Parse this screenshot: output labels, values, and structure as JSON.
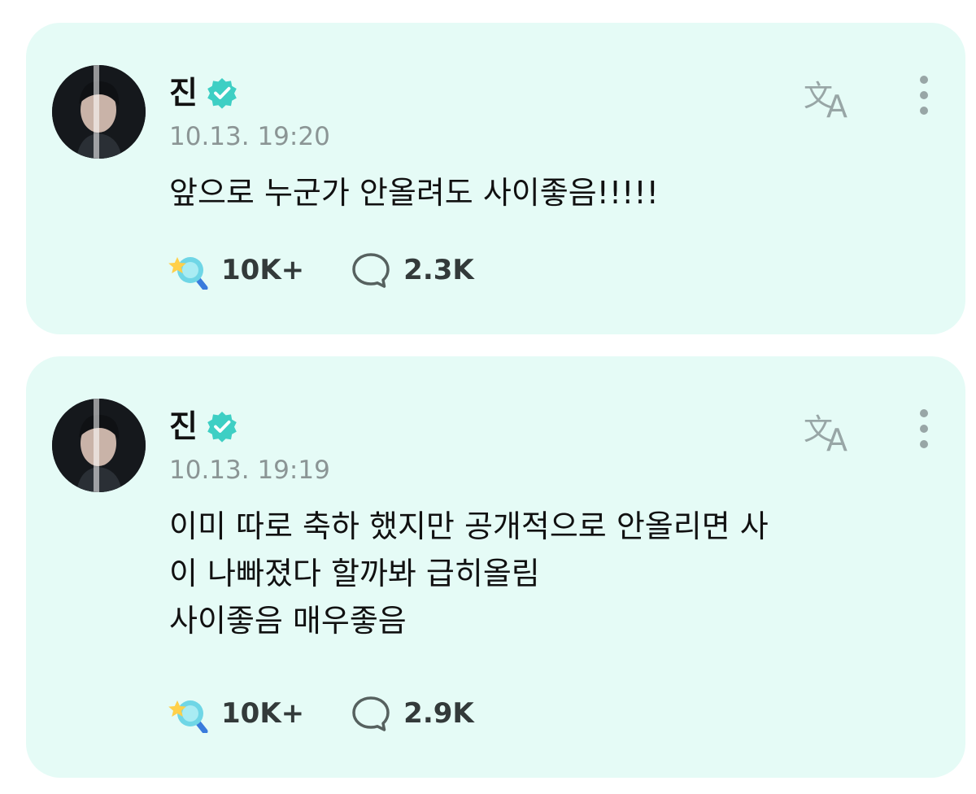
{
  "colors": {
    "card_background": "#e5fbf6",
    "verified_badge": "#3ecfc4",
    "icon_gray": "#98a6a6",
    "timestamp_text": "#8b9595"
  },
  "posts": [
    {
      "author": "진",
      "verified_icon": "verified-badge-icon",
      "timestamp": "10.13. 19:20",
      "body_lines": [
        "앞으로 누군가 안올려도 사이좋음!!!!!"
      ],
      "like_icon": "star-magnifier-icon",
      "like_count": "10K+",
      "comment_icon": "comment-bubble-icon",
      "comment_count": "2.3K"
    },
    {
      "author": "진",
      "verified_icon": "verified-badge-icon",
      "timestamp": "10.13. 19:19",
      "body_lines": [
        "이미 따로 축하 했지만 공개적으로 안올리면 사",
        "이 나빠졌다 할까봐 급히올림",
        "사이좋음 매우좋음"
      ],
      "like_icon": "star-magnifier-icon",
      "like_count": "10K+",
      "comment_icon": "comment-bubble-icon",
      "comment_count": "2.9K"
    }
  ]
}
